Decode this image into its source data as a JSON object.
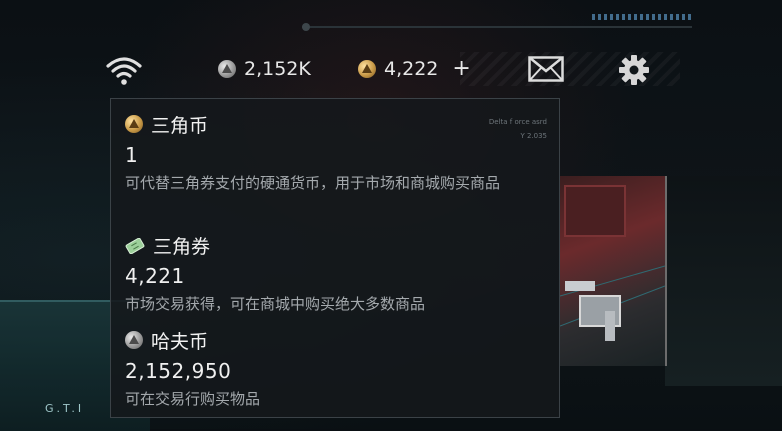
{
  "hud": {
    "haf_balance": "2,152K",
    "triangle_balance": "4,222",
    "plus_label": "+",
    "icons": [
      "wifi-icon",
      "silver-coin-icon",
      "gold-coin-icon",
      "plus-icon",
      "mail-icon",
      "gear-icon"
    ]
  },
  "panel": {
    "faint_line_1": "Delta f  orce asrd",
    "faint_line_2": "Y  2.035",
    "entries": [
      {
        "icon": "triangle-coin-icon",
        "name": "三角币",
        "amount": "1",
        "description": "可代替三角券支付的硬通货币，用于市场和商城购买商品"
      },
      {
        "icon": "triangle-ticket-icon",
        "name": "三角券",
        "amount": "4,221",
        "description": "市场交易获得，可在商城中购买绝大多数商品"
      },
      {
        "icon": "haf-coin-icon",
        "name": "哈夫币",
        "amount": "2,152,950",
        "description": "可在交易行购买物品"
      }
    ]
  },
  "background": {
    "left_panel_text": "G.T.I"
  },
  "colors": {
    "gold": "#c99a47",
    "silver": "#9a9a9a",
    "ticket_green": "#9ccf9a",
    "panel_bg": "#14181b",
    "desc_text": "#a4a9ad"
  }
}
